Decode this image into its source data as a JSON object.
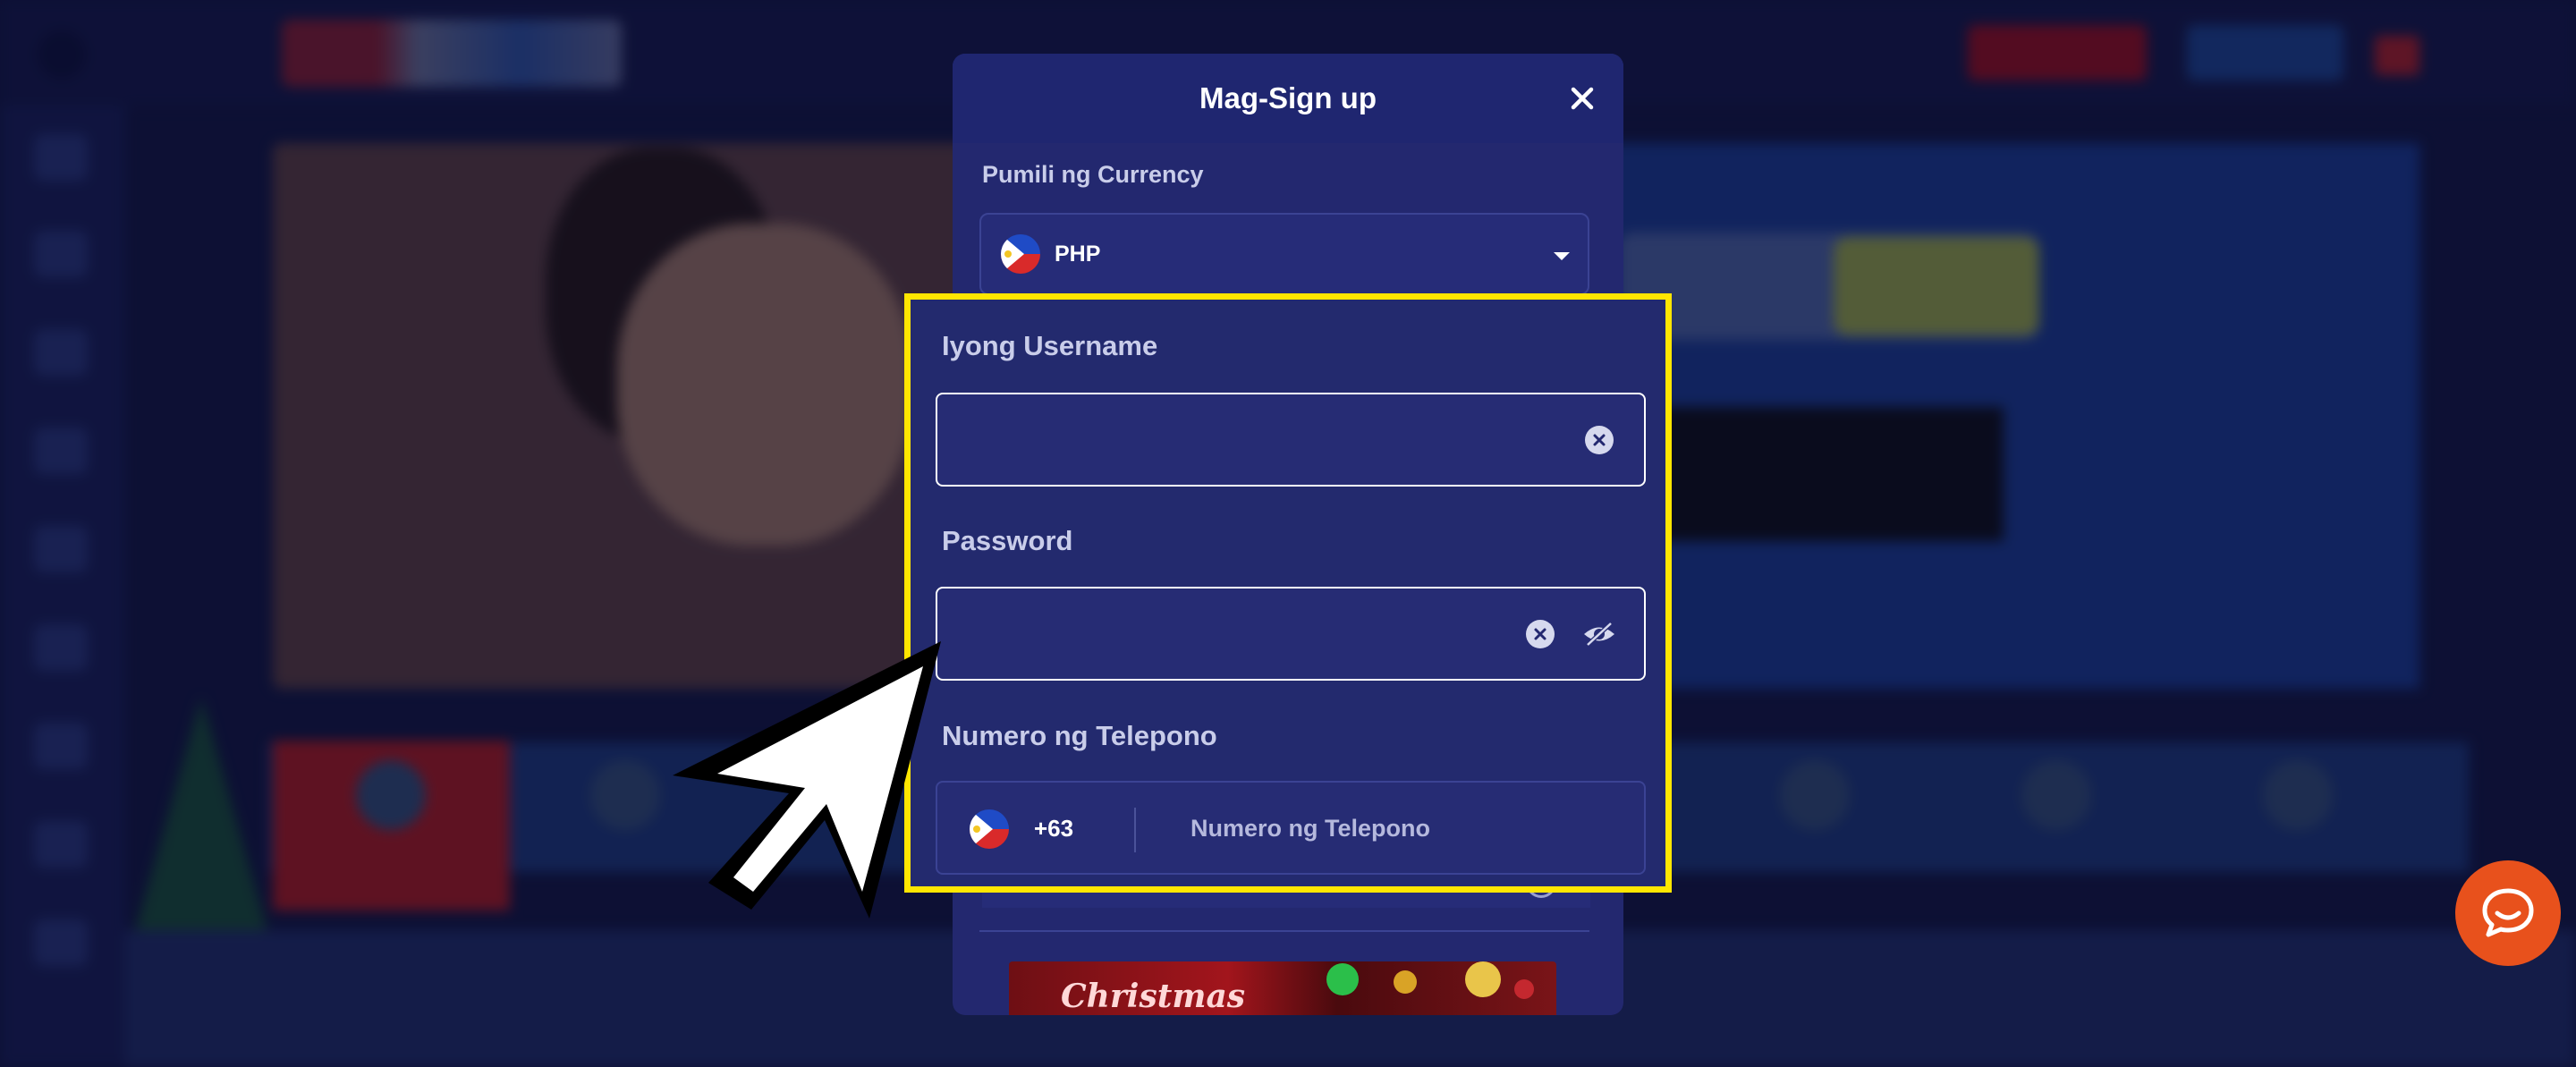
{
  "modal": {
    "title": "Mag-Sign up",
    "currency_label": "Pumili ng Currency",
    "currency_value": "PHP",
    "username_label": "Iyong Username",
    "username_value": "",
    "password_label": "Password",
    "password_value": "",
    "phone_label": "Numero ng Telepono",
    "phone_code": "+63",
    "phone_placeholder": "Numero ng Telepono",
    "banner_text": "Christmas"
  },
  "colors": {
    "modal_bg": "#23286f",
    "highlight": "#ffe600",
    "chat_button": "#e8511c",
    "page_bg": "#141a4a"
  },
  "icons": {
    "close": "close-icon",
    "clear": "clear-input-icon",
    "visibility": "eye-slash-icon",
    "flag": "philippines-flag-icon",
    "dropdown": "chevron-down-icon",
    "chat": "chat-bubble-icon",
    "pointer": "mouse-pointer-icon"
  }
}
